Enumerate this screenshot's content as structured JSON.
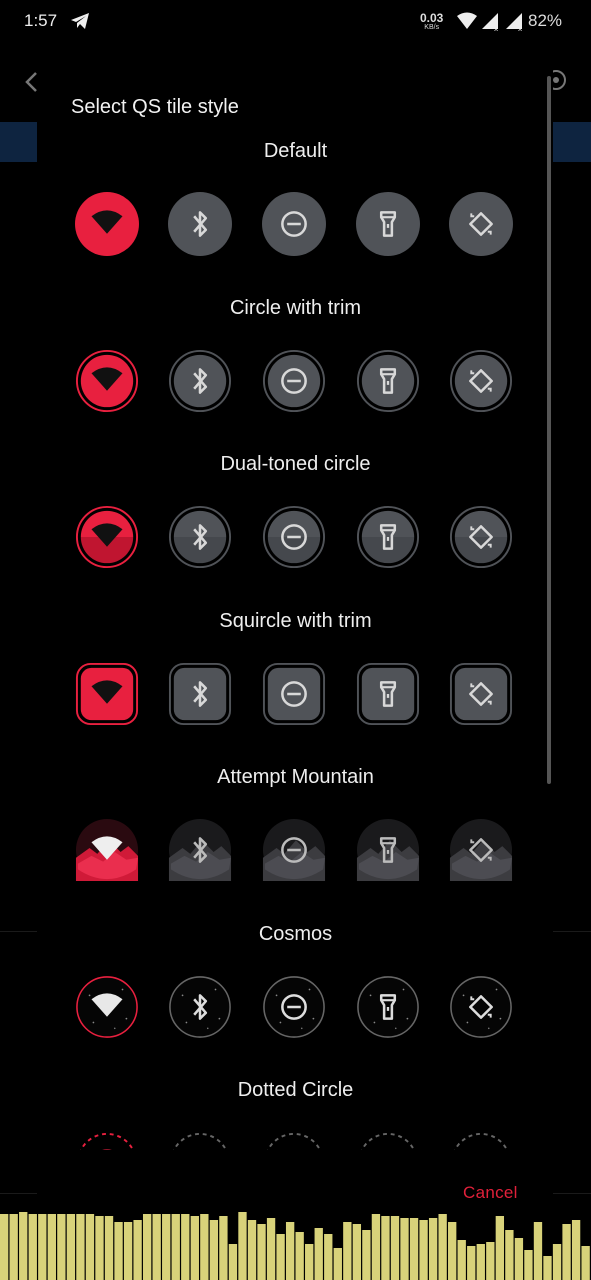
{
  "status_bar": {
    "time": "1:57",
    "net_speed_value": "0.03",
    "net_speed_unit": "KB/s",
    "battery": "82%"
  },
  "dialog": {
    "title": "Select QS tile style",
    "cancel_label": "Cancel"
  },
  "styles": [
    {
      "name": "Default",
      "shape": "circle"
    },
    {
      "name": "Circle with trim",
      "shape": "circle-trim"
    },
    {
      "name": "Dual-toned circle",
      "shape": "dual"
    },
    {
      "name": "Squircle with trim",
      "shape": "squircle"
    },
    {
      "name": "Attempt Mountain",
      "shape": "mountain"
    },
    {
      "name": "Cosmos",
      "shape": "cosmos"
    },
    {
      "name": "Dotted Circle",
      "shape": "dotted"
    }
  ],
  "tile_icons": [
    "wifi-icon",
    "bluetooth-icon",
    "dnd-icon",
    "flashlight-icon",
    "auto-rotate-icon"
  ],
  "colors": {
    "accent": "#e8203f",
    "tile_inactive": "#505358",
    "icon_inactive": "#d8d8d8",
    "equalizer": "#d8d27a"
  }
}
